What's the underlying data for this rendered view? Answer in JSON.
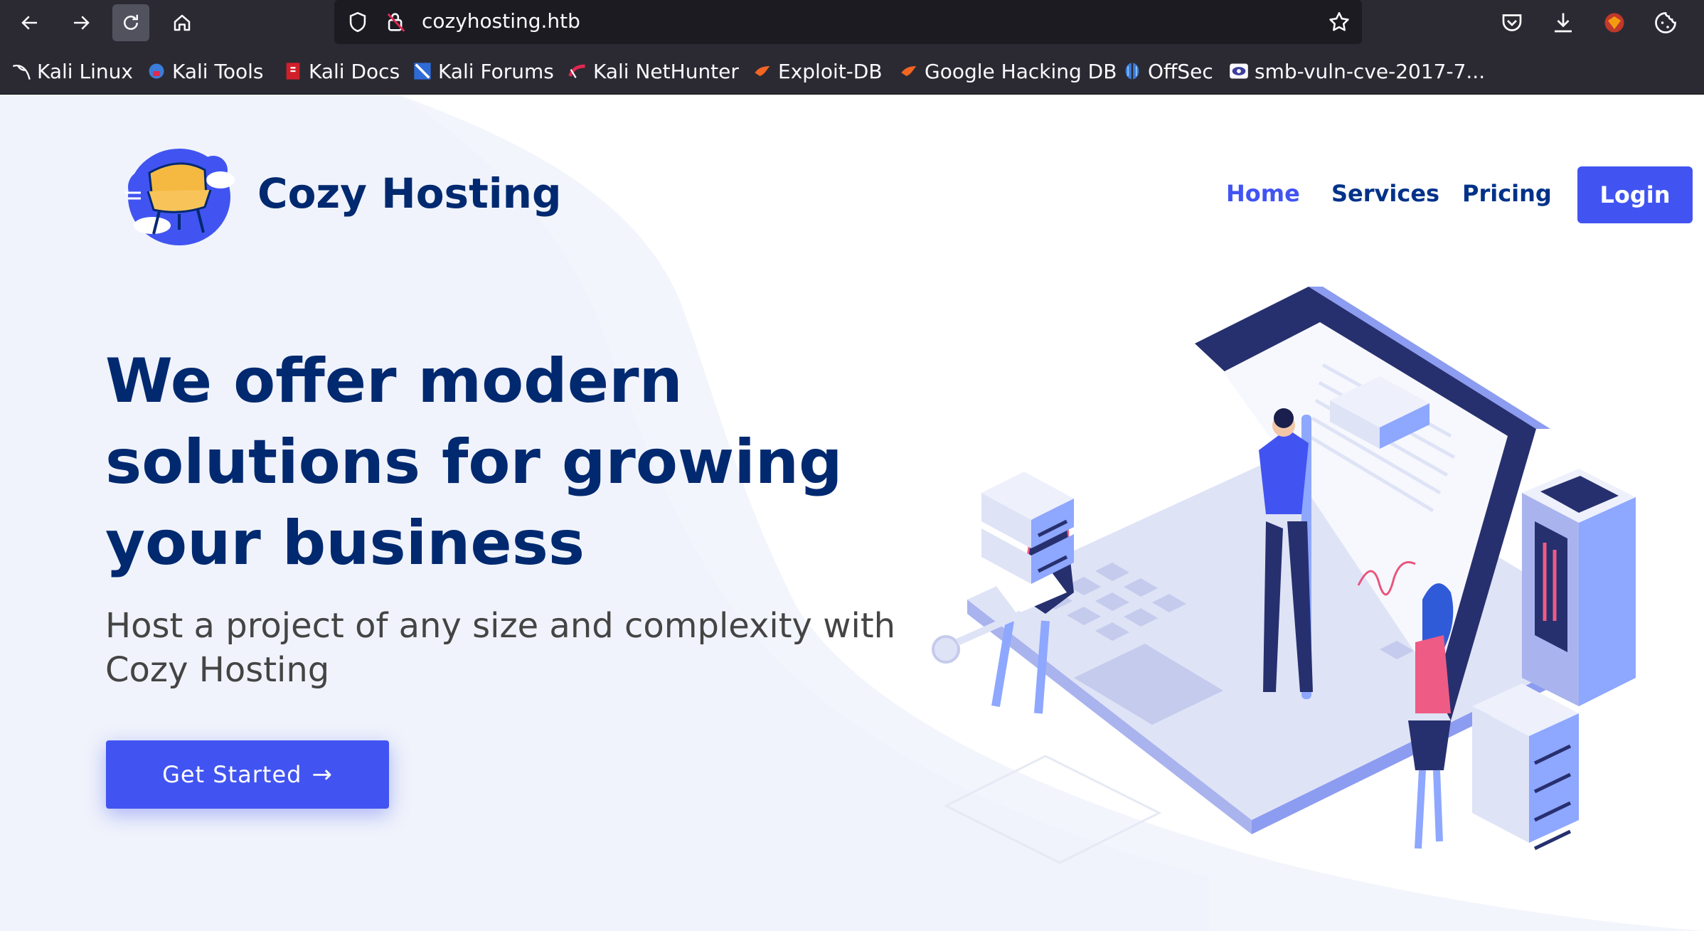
{
  "browser": {
    "url": "cozyhosting.htb",
    "bookmarks": [
      {
        "label": "Kali Linux",
        "icon": "kali-dragon-icon"
      },
      {
        "label": "Kali Tools",
        "icon": "kali-tools-icon"
      },
      {
        "label": "Kali Docs",
        "icon": "kali-docs-icon"
      },
      {
        "label": "Kali Forums",
        "icon": "kali-forums-icon"
      },
      {
        "label": "Kali NetHunter",
        "icon": "kali-nethunter-icon"
      },
      {
        "label": "Exploit-DB",
        "icon": "exploit-db-icon"
      },
      {
        "label": "Google Hacking DB",
        "icon": "ghdb-icon"
      },
      {
        "label": "OffSec",
        "icon": "offsec-icon"
      },
      {
        "label": "smb-vuln-cve-2017-7...",
        "icon": "eye-icon"
      }
    ]
  },
  "site": {
    "brand": "Cozy Hosting",
    "nav": {
      "home": "Home",
      "services": "Services",
      "pricing": "Pricing",
      "login": "Login"
    },
    "hero": {
      "title": "We offer modern solutions for growing your business",
      "subtitle": "Host a project of any size and complexity with Cozy Hosting",
      "cta": "Get Started",
      "cta_arrow": "→"
    }
  },
  "colors": {
    "accent": "#4154f1",
    "heading": "#012970",
    "nav": "#013289",
    "browser_bg": "#2b2a33"
  }
}
